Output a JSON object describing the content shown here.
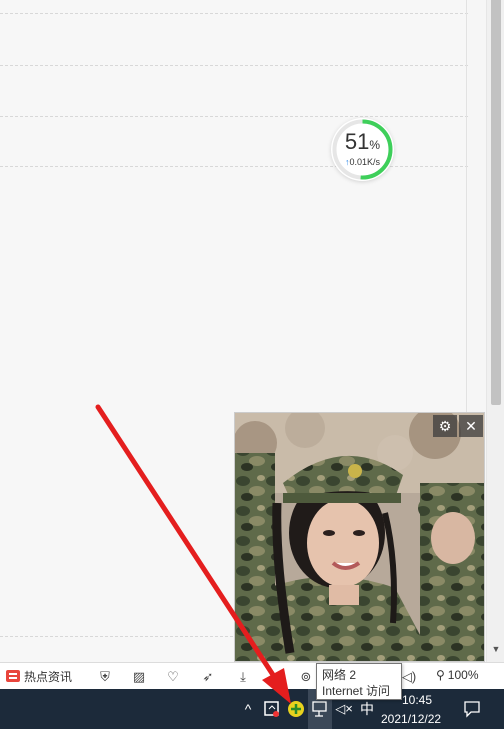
{
  "speed_widget": {
    "percent": "51",
    "unit": "%",
    "rate": "0.01K/s",
    "fraction": 0.51
  },
  "popup": {
    "settings_icon": "settings-icon",
    "close_icon": "close-icon"
  },
  "bottom_bar": {
    "news_label": "热点资讯",
    "icons": [
      "shield-icon",
      "image-icon",
      "heart-icon",
      "rocket-icon",
      "download-icon",
      "cloud-icon",
      "glasses-icon",
      "volume-icon",
      "search-icon"
    ],
    "zoom": "100%"
  },
  "taskbar": {
    "ime": "中",
    "time": "10:45",
    "date": "2021/12/22"
  },
  "tooltip": {
    "line1": "网络 2",
    "line2": "Internet 访问"
  },
  "colors": {
    "accent_green": "#3ecf5a",
    "annotation_red": "#e41e1e",
    "taskbar": "#1c2a3a"
  }
}
